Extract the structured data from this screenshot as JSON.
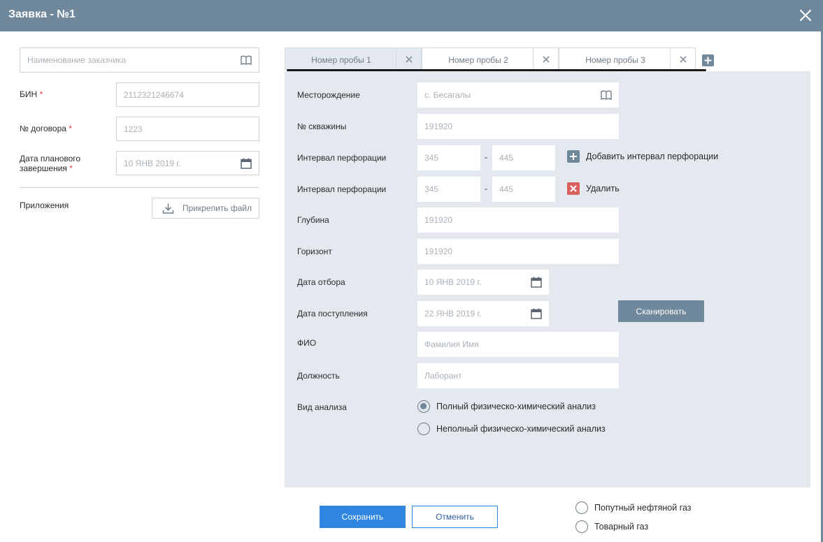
{
  "window": {
    "title": "Заявка - №1"
  },
  "left": {
    "customer_placeholder": "Наименование заказчика",
    "bin": {
      "label": "БИН",
      "value": "2112321246674"
    },
    "contract": {
      "label": "№ договора",
      "value": "1223"
    },
    "planned_date": {
      "label_line1": "Дата планового",
      "label_line2": "завершения",
      "value": "10 ЯНВ 2019 г."
    },
    "attachments": {
      "label": "Приложения",
      "button": "Прикрепить файл"
    },
    "required_mark": "*"
  },
  "tabs": [
    {
      "label": "Номер пробы 1",
      "active": true
    },
    {
      "label": "Номер пробы 2",
      "active": false
    },
    {
      "label": "Номер пробы 3",
      "active": false
    }
  ],
  "form": {
    "field": {
      "label": "Месторождение",
      "value": "с. Бесагалы"
    },
    "well": {
      "label": "№ скважины",
      "value": "191920"
    },
    "perf1": {
      "label": "Интервал перфорации",
      "from": "345",
      "sep": "-",
      "to": "445",
      "action": "Добавить интервал перфорации"
    },
    "perf2": {
      "label": "Интервал перфорации",
      "from": "345",
      "sep": "-",
      "to": "445",
      "action": "Удалить"
    },
    "depth": {
      "label": "Глубина",
      "value": "191920"
    },
    "horizon": {
      "label": "Горизонт",
      "value": "191920"
    },
    "sample_date": {
      "label": "Дата отбора",
      "value": "10 ЯНВ 2019 г."
    },
    "receipt_date": {
      "label": "Дата поступления",
      "value": "22 ЯНВ 2019 г.",
      "scan_button": "Сканировать"
    },
    "fio": {
      "label": "ФИО",
      "placeholder": "Фамилия Имя"
    },
    "position": {
      "label": "Должность",
      "placeholder": "Лаборант"
    },
    "analysis": {
      "label": "Вид анализа",
      "options": [
        {
          "label": "Полный физическо-химический анализ",
          "selected": true
        },
        {
          "label": "Неполный физическо-химический анализ",
          "selected": false
        }
      ]
    }
  },
  "footer": {
    "save": "Сохранить",
    "cancel": "Отменить",
    "gas_options": [
      {
        "label": "Попутный нефтяной газ",
        "selected": false
      },
      {
        "label": "Товарный газ",
        "selected": false
      }
    ]
  },
  "colors": {
    "header": "#6f889c",
    "panel": "#e3e9ef",
    "primary": "#2f86e0",
    "danger": "#d9605f",
    "required": "#e03a3a"
  }
}
